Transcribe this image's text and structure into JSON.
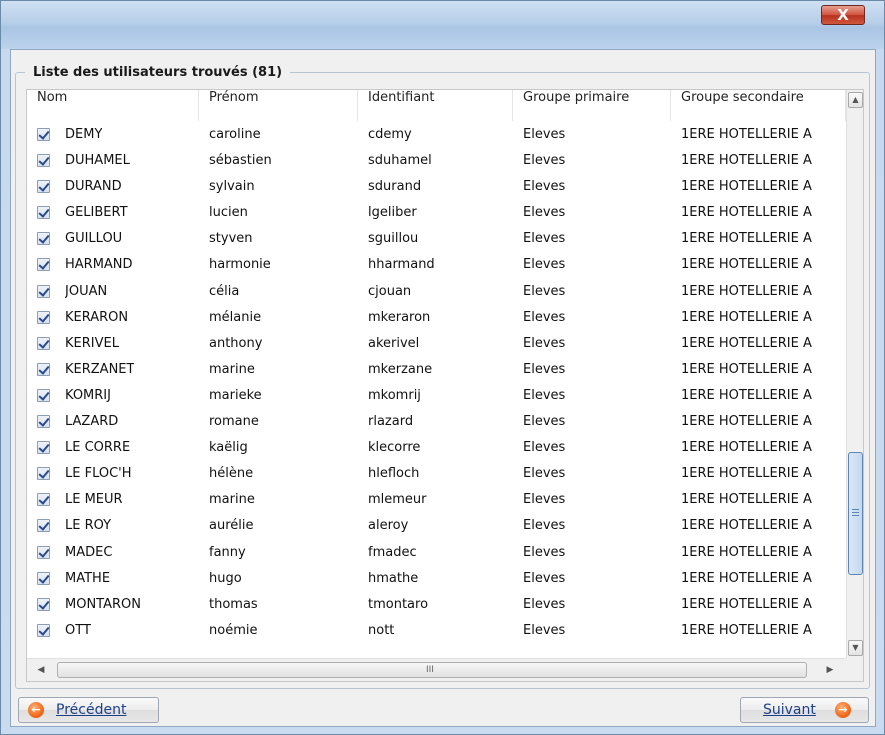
{
  "window": {
    "close_glyph": "X"
  },
  "group_title": "Liste des utilisateurs trouvés (81)",
  "columns": [
    "Nom",
    "Prénom",
    "Identifiant",
    "Groupe primaire",
    "Groupe secondaire"
  ],
  "rows": [
    {
      "nom": "DEMY",
      "prenom": "caroline",
      "id": "cdemy",
      "primaire": "Eleves",
      "secondaire": "1ERE HOTELLERIE A",
      "checked": true
    },
    {
      "nom": "DUHAMEL",
      "prenom": "sébastien",
      "id": "sduhamel",
      "primaire": "Eleves",
      "secondaire": "1ERE HOTELLERIE A",
      "checked": true
    },
    {
      "nom": "DURAND",
      "prenom": "sylvain",
      "id": "sdurand",
      "primaire": "Eleves",
      "secondaire": "1ERE HOTELLERIE A",
      "checked": true
    },
    {
      "nom": "GELIBERT",
      "prenom": "lucien",
      "id": "lgeliber",
      "primaire": "Eleves",
      "secondaire": "1ERE HOTELLERIE A",
      "checked": true
    },
    {
      "nom": "GUILLOU",
      "prenom": "styven",
      "id": "sguillou",
      "primaire": "Eleves",
      "secondaire": "1ERE HOTELLERIE A",
      "checked": true
    },
    {
      "nom": "HARMAND",
      "prenom": "harmonie",
      "id": "hharmand",
      "primaire": "Eleves",
      "secondaire": "1ERE HOTELLERIE A",
      "checked": true
    },
    {
      "nom": "JOUAN",
      "prenom": "célia",
      "id": "cjouan",
      "primaire": "Eleves",
      "secondaire": "1ERE HOTELLERIE A",
      "checked": true
    },
    {
      "nom": "KERARON",
      "prenom": "mélanie",
      "id": "mkeraron",
      "primaire": "Eleves",
      "secondaire": "1ERE HOTELLERIE A",
      "checked": true
    },
    {
      "nom": "KERIVEL",
      "prenom": "anthony",
      "id": "akerivel",
      "primaire": "Eleves",
      "secondaire": "1ERE HOTELLERIE A",
      "checked": true
    },
    {
      "nom": "KERZANET",
      "prenom": "marine",
      "id": "mkerzane",
      "primaire": "Eleves",
      "secondaire": "1ERE HOTELLERIE A",
      "checked": true
    },
    {
      "nom": "KOMRIJ",
      "prenom": "marieke",
      "id": "mkomrij",
      "primaire": "Eleves",
      "secondaire": "1ERE HOTELLERIE A",
      "checked": true
    },
    {
      "nom": "LAZARD",
      "prenom": "romane",
      "id": "rlazard",
      "primaire": "Eleves",
      "secondaire": "1ERE HOTELLERIE A",
      "checked": true
    },
    {
      "nom": "LE CORRE",
      "prenom": "kaëlig",
      "id": "klecorre",
      "primaire": "Eleves",
      "secondaire": "1ERE HOTELLERIE A",
      "checked": true
    },
    {
      "nom": "LE FLOC'H",
      "prenom": "hélène",
      "id": "hlefloch",
      "primaire": "Eleves",
      "secondaire": "1ERE HOTELLERIE A",
      "checked": true
    },
    {
      "nom": "LE MEUR",
      "prenom": "marine",
      "id": "mlemeur",
      "primaire": "Eleves",
      "secondaire": "1ERE HOTELLERIE A",
      "checked": true
    },
    {
      "nom": "LE ROY",
      "prenom": "aurélie",
      "id": "aleroy",
      "primaire": "Eleves",
      "secondaire": "1ERE HOTELLERIE A",
      "checked": true
    },
    {
      "nom": "MADEC",
      "prenom": "fanny",
      "id": "fmadec",
      "primaire": "Eleves",
      "secondaire": "1ERE HOTELLERIE A",
      "checked": true
    },
    {
      "nom": "MATHE",
      "prenom": "hugo",
      "id": "hmathe",
      "primaire": "Eleves",
      "secondaire": "1ERE HOTELLERIE A",
      "checked": true
    },
    {
      "nom": "MONTARON",
      "prenom": "thomas",
      "id": "tmontaro",
      "primaire": "Eleves",
      "secondaire": "1ERE HOTELLERIE A",
      "checked": true
    },
    {
      "nom": "OTT",
      "prenom": "noémie",
      "id": "nott",
      "primaire": "Eleves",
      "secondaire": "1ERE HOTELLERIE A",
      "checked": true
    }
  ],
  "scroll": {
    "h_grip": "III"
  },
  "buttons": {
    "previous": "Précédent",
    "next": "Suivant"
  },
  "icons": {
    "close": "close-icon",
    "previous": "arrow-left-icon",
    "next": "arrow-right-icon"
  }
}
